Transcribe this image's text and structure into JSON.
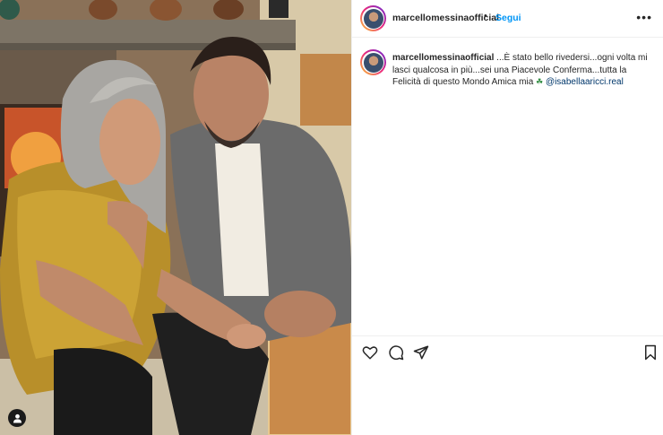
{
  "header": {
    "username": "marcellomessinaofficial",
    "separator": "•",
    "follow_label": "Segui",
    "more_icon": "more-horizontal-icon"
  },
  "caption": {
    "username": "marcellomessinaofficial",
    "text": "...È stato bello rivedersi...ogni volta mi lasci qualcosa in più...sei una Piacevole Conferma...tutta la Felicità di questo Mondo Amica mia",
    "emoji": "herb-emoji",
    "mention": "@isabellaaricci.real"
  },
  "actions": {
    "like_icon": "heart-icon",
    "comment_icon": "comment-icon",
    "share_icon": "send-icon",
    "save_icon": "bookmark-icon"
  },
  "photo": {
    "tag_icon": "user-tag-icon"
  },
  "colors": {
    "link_blue": "#0095f6",
    "mention": "#00376b",
    "text": "#262626",
    "border": "#efefef"
  }
}
